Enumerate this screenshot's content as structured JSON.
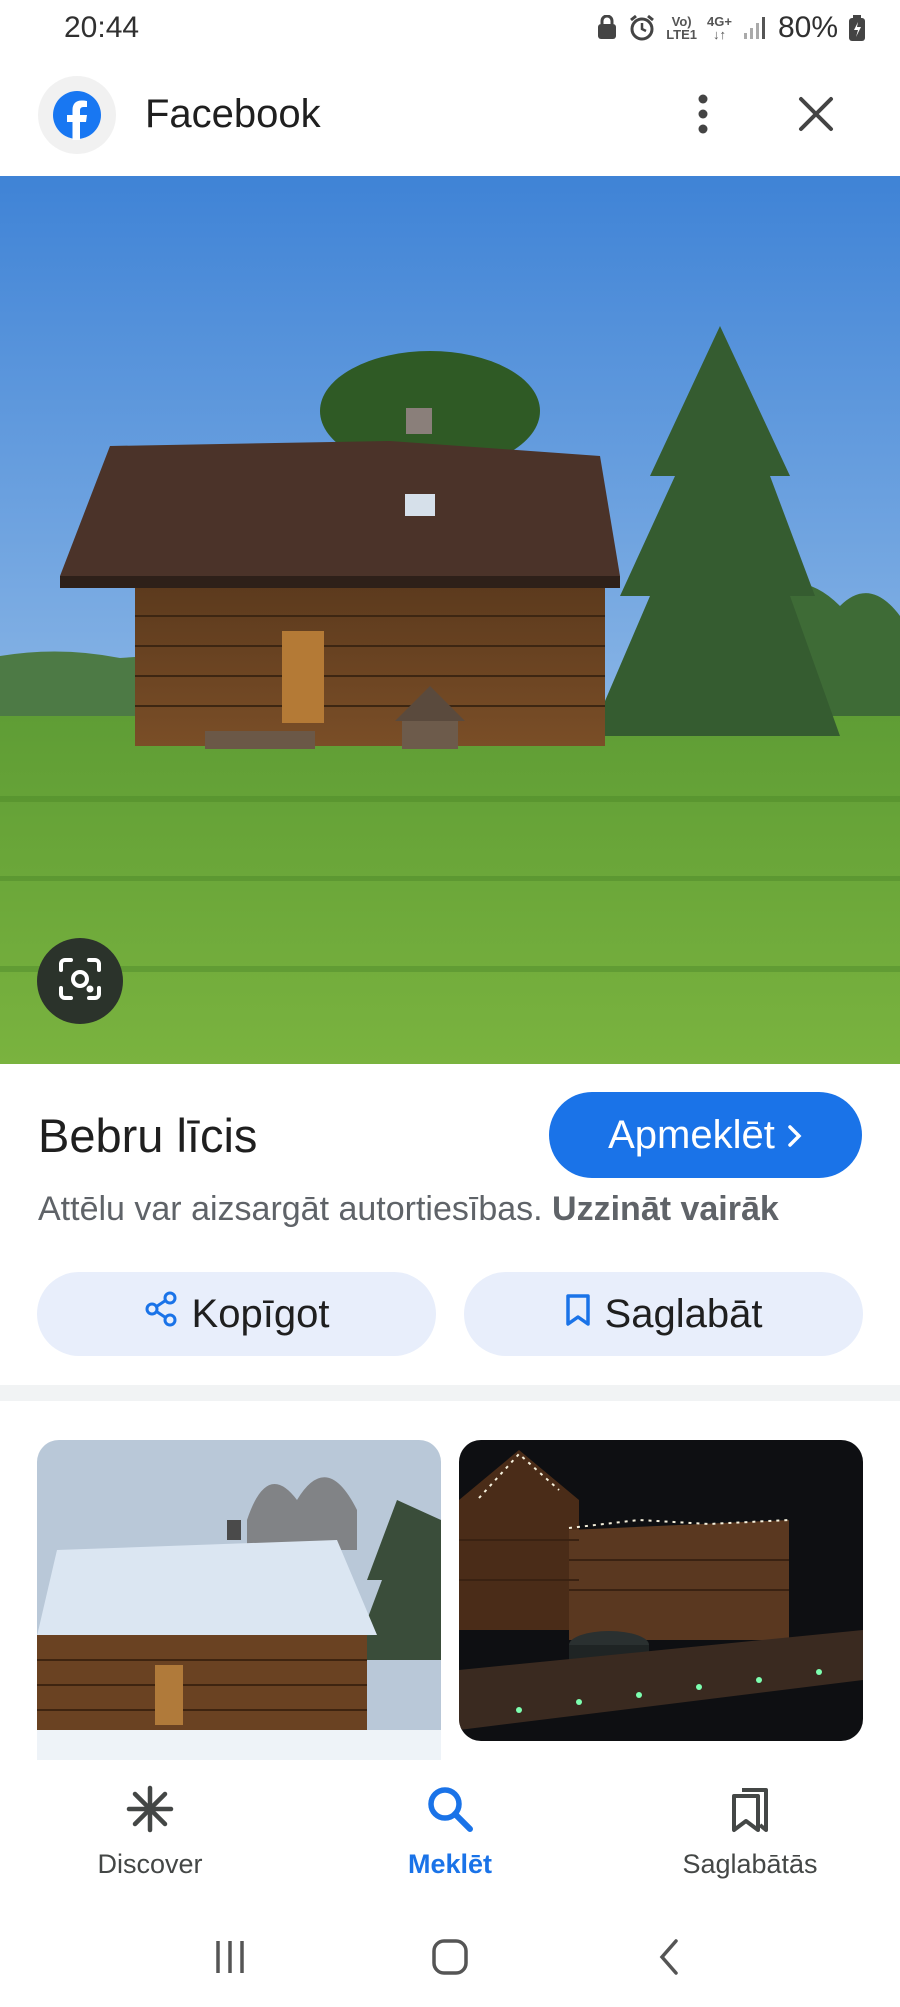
{
  "status_bar": {
    "time": "20:44",
    "network_top": "Vo)",
    "network_bottom": "LTE1",
    "data_type": "4G+",
    "battery": "80%"
  },
  "app_bar": {
    "title": "Facebook"
  },
  "result": {
    "title": "Bebru līcis",
    "visit_label": "Apmeklēt",
    "copyright_text": "Attēlu var aizsargāt autortiesības.",
    "learn_more": "Uzzināt vairāk"
  },
  "actions": {
    "share_label": "Kopīgot",
    "save_label": "Saglabāt"
  },
  "bottom_nav": {
    "items": [
      {
        "label": "Discover",
        "icon": "asterisk-icon"
      },
      {
        "label": "Meklēt",
        "icon": "search-icon",
        "active": true
      },
      {
        "label": "Saglabātās",
        "icon": "bookmarks-icon"
      }
    ]
  },
  "colors": {
    "accent": "#1a73e8",
    "button_bg": "#e8eefb",
    "text": "#1f1f1f",
    "muted": "#5f6368"
  }
}
